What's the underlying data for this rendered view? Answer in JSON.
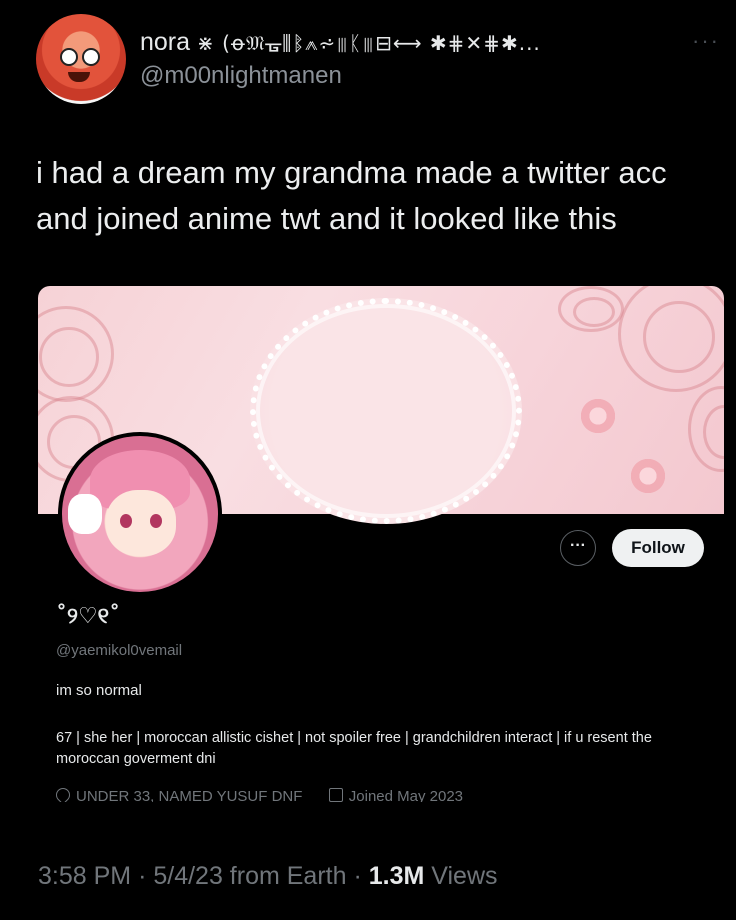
{
  "tweet": {
    "display_name": "nora",
    "display_name_glyphs": "⋇ (ꝋ𝔐ᚗ⫼ᛔ⩕⩫⫼ᛕ⫼⊟⟷ ✱⋕✕⋕✱...",
    "handle": "@m00nlightmanen",
    "more_icon": "more-dots-icon",
    "text_line1": "i had a dream my grandma made a twitter acc",
    "text_line2": "and joined anime twt and it looked like this",
    "time": "3:58 PM",
    "date": "5/4/23 from Earth",
    "views_count": "1.3M",
    "views_label": "Views",
    "separator": "·"
  },
  "embedded_profile": {
    "name": "˚୨♡୧˚",
    "handle": "@yaemikol0vemail",
    "status": "im so normal",
    "bio": "67 | she her | moroccan allistic cishet | not spoiler free | grandchildren interact | if u resent the moroccan goverment dni",
    "location": "UNDER 33, NAMED YUSUF DNF",
    "joined": "Joined May 2023",
    "follow_label": "Follow",
    "more_label": "···"
  },
  "colors": {
    "background": "#000000",
    "text": "#e7e9ea",
    "secondary_text": "#71767b",
    "banner_pink": "#f7d4da",
    "follow_button": "#eff1f2"
  }
}
